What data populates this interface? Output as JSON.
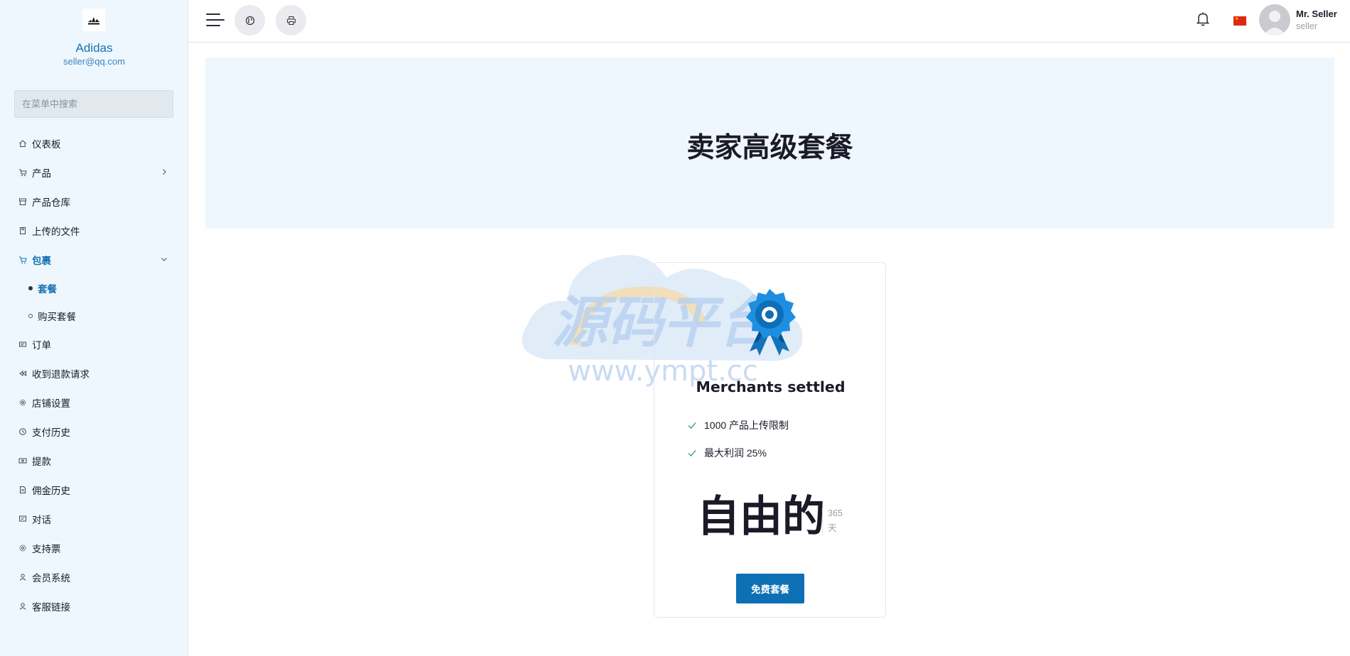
{
  "sidebar": {
    "brand_name": "Adidas",
    "brand_email": "seller@qq.com",
    "logo_icon": "adidas-logo",
    "search_placeholder": "在菜单中搜索",
    "items": [
      {
        "label": "仪表板",
        "icon": "home-icon"
      },
      {
        "label": "产品",
        "icon": "cart-icon",
        "has_children": true
      },
      {
        "label": "产品仓库",
        "icon": "archive-icon"
      },
      {
        "label": "上传的文件",
        "icon": "folder-icon"
      },
      {
        "label": "包裹",
        "icon": "cart-icon",
        "active": true,
        "expanded": true
      },
      {
        "label": "订单",
        "icon": "ticket-icon"
      },
      {
        "label": "收到退款请求",
        "icon": "rewind-icon"
      },
      {
        "label": "店铺设置",
        "icon": "gear-icon"
      },
      {
        "label": "支付历史",
        "icon": "history-icon"
      },
      {
        "label": "提款",
        "icon": "money-icon"
      },
      {
        "label": "佣金历史",
        "icon": "document-icon"
      },
      {
        "label": "对话",
        "icon": "chat-icon"
      },
      {
        "label": "支持票",
        "icon": "support-icon"
      },
      {
        "label": "会员系统",
        "icon": "user-icon"
      },
      {
        "label": "客服链接",
        "icon": "user-icon"
      }
    ],
    "sub_items": [
      {
        "label": "套餐",
        "active": true
      },
      {
        "label": "购买套餐",
        "active": false
      }
    ]
  },
  "topbar": {
    "menu_icon": "hamburger-icon",
    "globe_icon": "globe-icon",
    "print_icon": "printer-icon",
    "notification_icon": "bell-icon",
    "language_flag": "china-flag",
    "user_name": "Mr. Seller",
    "user_role": "seller"
  },
  "hero": {
    "title": "卖家高级套餐"
  },
  "watermark": {
    "text": "源码平台",
    "url": "www.ympt.cc"
  },
  "plan": {
    "icon": "award-badge-icon",
    "name": "Merchants settled",
    "features": [
      "1000 产品上传限制",
      "最大利润 25%"
    ],
    "price": "自由的",
    "duration_value": "365",
    "duration_unit": "天",
    "button_label": "免费套餐"
  },
  "colors": {
    "accent": "#1771b5",
    "button": "#0d6fb4",
    "sidebar_bg": "#eef7fd",
    "check": "#3fa37a"
  }
}
